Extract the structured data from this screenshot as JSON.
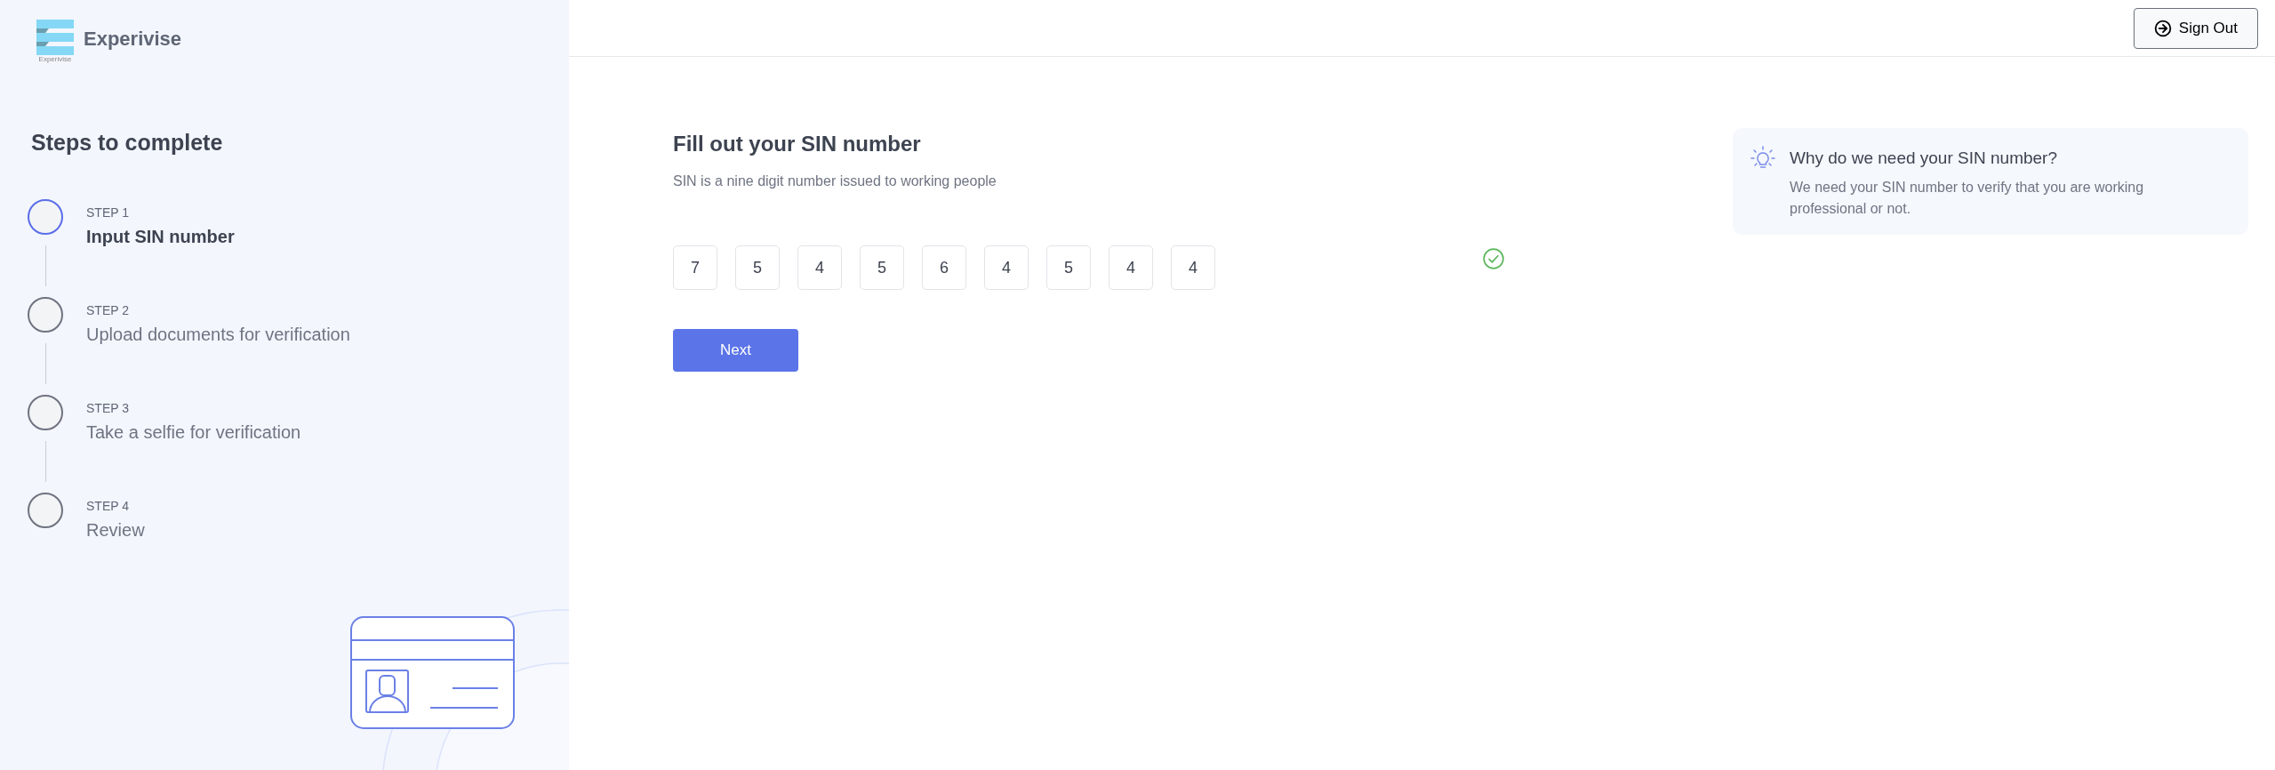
{
  "sidebar": {
    "logo": {
      "name": "Experivise",
      "caption": "Experivise"
    },
    "heading": "Steps to complete",
    "steps": [
      {
        "label": "STEP 1",
        "title": "Input SIN number",
        "selected": true
      },
      {
        "label": "STEP 2",
        "title": "Upload documents for verification",
        "selected": false
      },
      {
        "label": "STEP 3",
        "title": "Take a selfie for verification",
        "selected": false
      },
      {
        "label": "STEP 4",
        "title": "Review",
        "selected": false
      }
    ]
  },
  "header": {
    "sign_out": "Sign Out"
  },
  "form": {
    "title": "Fill out your SIN number",
    "subtitle": "SIN is a nine digit number issued to working people",
    "digits": [
      "7",
      "5",
      "4",
      "5",
      "6",
      "4",
      "5",
      "4",
      "4"
    ],
    "valid": true,
    "next": "Next"
  },
  "info": {
    "title": "Why do we need your SIN number?",
    "text": "We need your SIN number to verify that you are working professional or not."
  }
}
